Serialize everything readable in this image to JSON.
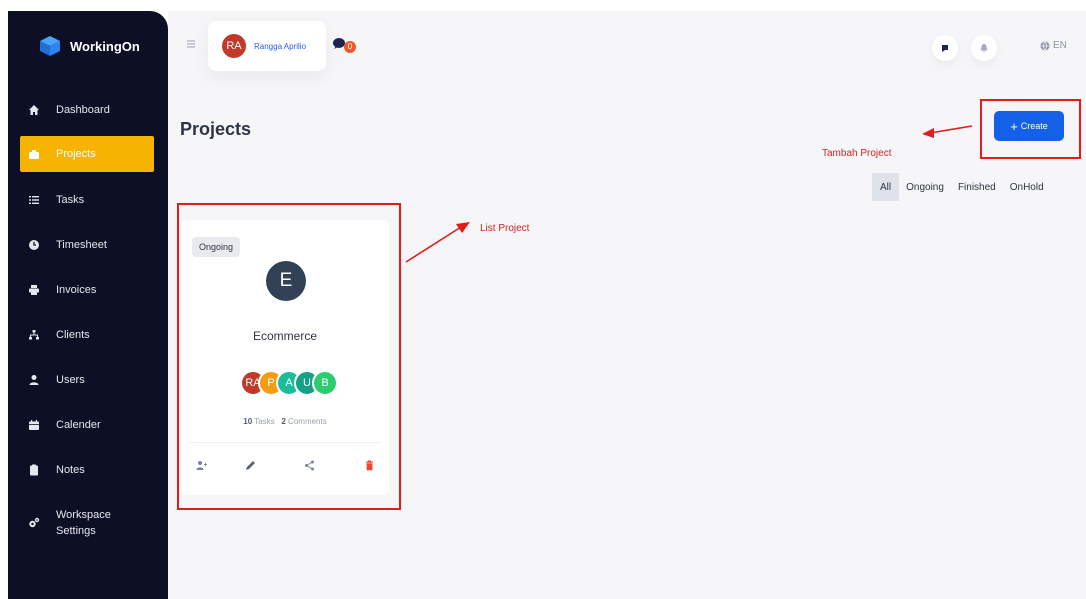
{
  "app": {
    "brand": "WorkingOn"
  },
  "sidebar": {
    "items": [
      {
        "label": "Dashboard",
        "icon": "home-icon",
        "active": false
      },
      {
        "label": "Projects",
        "icon": "briefcase-icon",
        "active": true
      },
      {
        "label": "Tasks",
        "icon": "list-icon",
        "active": false
      },
      {
        "label": "Timesheet",
        "icon": "clock-icon",
        "active": false
      },
      {
        "label": "Invoices",
        "icon": "printer-icon",
        "active": false
      },
      {
        "label": "Clients",
        "icon": "sitemap-icon",
        "active": false
      },
      {
        "label": "Users",
        "icon": "user-icon",
        "active": false
      },
      {
        "label": "Calender",
        "icon": "calendar-icon",
        "active": false
      },
      {
        "label": "Notes",
        "icon": "clipboard-icon",
        "active": false
      },
      {
        "label_line1": "Workspace",
        "label_line2": "Settings",
        "icon": "cogs-icon",
        "active": false
      }
    ]
  },
  "topbar": {
    "user_initials": "RA",
    "user_name": "Rangga Aprilio",
    "chat_count": "0",
    "language": "EN"
  },
  "page": {
    "title": "Projects",
    "create_label": "Create"
  },
  "filters": [
    "All",
    "Ongoing",
    "Finished",
    "OnHold"
  ],
  "annotations": {
    "create": "Tambah Project",
    "list": "List Project"
  },
  "project_card": {
    "status": "Ongoing",
    "avatar_letter": "E",
    "name": "Ecommerce",
    "members": [
      {
        "initials": "RA",
        "color": "#c0392b"
      },
      {
        "initials": "P",
        "color": "#f39c12"
      },
      {
        "initials": "A",
        "color": "#1abc9c"
      },
      {
        "initials": "U",
        "color": "#16a085"
      },
      {
        "initials": "B",
        "color": "#2ecc71"
      }
    ],
    "tasks_count": "10",
    "tasks_label": "Tasks",
    "comments_count": "2",
    "comments_label": "Comments"
  },
  "colors": {
    "sidebar_bg": "#0d0f24",
    "active_nav": "#f6b400",
    "primary": "#1560e8",
    "annotation": "#e21b1b",
    "danger": "#f0452b"
  }
}
